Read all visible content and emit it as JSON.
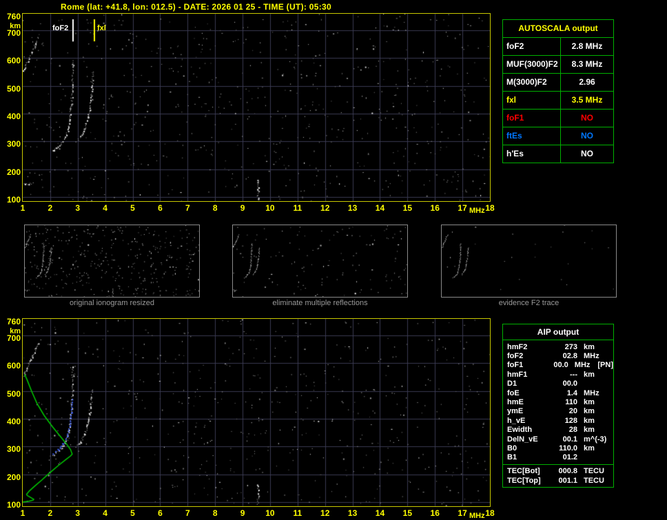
{
  "title": "Rome (lat: +41.8, lon: 012.5) - DATE: 2026 01 25 - TIME (UT): 05:30",
  "ionogram": {
    "x_unit": "MHz",
    "y_unit": "km",
    "foF2_marker": "foF2",
    "fxI_marker": "fxl",
    "x_ticks": [
      1,
      2,
      3,
      4,
      5,
      6,
      7,
      8,
      9,
      10,
      11,
      12,
      13,
      14,
      15,
      16,
      17,
      18
    ],
    "y_ticks": [
      760,
      700,
      600,
      500,
      400,
      300,
      200,
      100
    ]
  },
  "autoscala": {
    "header": "AUTOSCALA output",
    "rows": [
      {
        "label": "foF2",
        "value": "2.8 MHz",
        "color": "white"
      },
      {
        "label": "MUF(3000)F2",
        "value": "8.3 MHz",
        "color": "white"
      },
      {
        "label": "M(3000)F2",
        "value": "2.96",
        "color": "white"
      },
      {
        "label": "fxl",
        "value": "3.5 MHz",
        "color": "yellow"
      },
      {
        "label": "foF1",
        "value": "NO",
        "color": "red"
      },
      {
        "label": "ftEs",
        "value": "NO",
        "color": "blue"
      },
      {
        "label": "h'Es",
        "value": "NO",
        "color": "white"
      }
    ]
  },
  "thumbnails": [
    {
      "caption": "original ionogram resized"
    },
    {
      "caption": "eliminate multiple reflections"
    },
    {
      "caption": "evidence F2 trace"
    }
  ],
  "aip": {
    "header": "AIP output",
    "rows": [
      {
        "label": "hmF2",
        "value": "273",
        "unit": "km",
        "extra": ""
      },
      {
        "label": "foF2",
        "value": "02.8",
        "unit": "MHz",
        "extra": ""
      },
      {
        "label": "foF1",
        "value": "00.0",
        "unit": "MHz",
        "extra": "[PN]"
      },
      {
        "label": "hmF1",
        "value": "---",
        "unit": "km",
        "extra": ""
      },
      {
        "label": "D1",
        "value": "00.0",
        "unit": "",
        "extra": ""
      },
      {
        "label": "foE",
        "value": "1.4",
        "unit": "MHz",
        "extra": ""
      },
      {
        "label": "hmE",
        "value": "110",
        "unit": "km",
        "extra": ""
      },
      {
        "label": "ymE",
        "value": "20",
        "unit": "km",
        "extra": ""
      },
      {
        "label": "h_vE",
        "value": "128",
        "unit": "km",
        "extra": ""
      },
      {
        "label": "Ewidth",
        "value": "28",
        "unit": "km",
        "extra": ""
      },
      {
        "label": "DelN_vE",
        "value": "00.1",
        "unit": "m^(-3)",
        "extra": ""
      },
      {
        "label": "B0",
        "value": "110.0",
        "unit": "km",
        "extra": ""
      },
      {
        "label": "B1",
        "value": "01.2",
        "unit": "",
        "extra": ""
      },
      {
        "label": "TEC[Bot]",
        "value": "000.8",
        "unit": "TECU",
        "extra": "",
        "sep": true
      },
      {
        "label": "TEC[Top]",
        "value": "001.1",
        "unit": "TECU",
        "extra": ""
      }
    ]
  },
  "chart_data": [
    {
      "id": "ionogram-main",
      "type": "scatter",
      "title": "",
      "xlabel": "MHz",
      "ylabel": "km",
      "xlim": [
        1,
        18
      ],
      "ylim": [
        100,
        760
      ],
      "x_ticks": [
        1,
        2,
        3,
        4,
        5,
        6,
        7,
        8,
        9,
        10,
        11,
        12,
        13,
        14,
        15,
        16,
        17,
        18
      ],
      "y_ticks": [
        760,
        700,
        600,
        500,
        400,
        300,
        200,
        100
      ],
      "grid": true,
      "markers": {
        "foF2_MHz": 2.8,
        "fxI_MHz": 3.5
      },
      "series": [
        {
          "name": "F2 ordinary trace",
          "style": "dots-white",
          "points": [
            [
              2.08,
              268
            ],
            [
              2.22,
              278
            ],
            [
              2.38,
              292
            ],
            [
              2.52,
              312
            ],
            [
              2.62,
              340
            ],
            [
              2.7,
              380
            ],
            [
              2.75,
              428
            ],
            [
              2.79,
              485
            ],
            [
              2.82,
              590
            ]
          ]
        },
        {
          "name": "F2 extraordinary trace",
          "style": "dots-white",
          "points": [
            [
              2.95,
              300
            ],
            [
              3.1,
              318
            ],
            [
              3.25,
              347
            ],
            [
              3.37,
              388
            ],
            [
              3.46,
              442
            ],
            [
              3.52,
              505
            ],
            [
              3.55,
              550
            ]
          ]
        },
        {
          "name": "multiple reflection",
          "style": "dots-white",
          "points": [
            [
              1.02,
              555
            ],
            [
              1.15,
              585
            ],
            [
              1.3,
              615
            ],
            [
              1.45,
              650
            ],
            [
              1.56,
              675
            ]
          ]
        },
        {
          "name": "sporadic echoes",
          "style": "dots-white",
          "points": [
            [
              1.02,
              150
            ],
            [
              1.18,
              147
            ],
            [
              1.35,
              151
            ]
          ]
        },
        {
          "name": "interference line",
          "style": "dots-white",
          "points": [
            [
              9.55,
              92
            ],
            [
              9.55,
              162
            ]
          ]
        }
      ]
    },
    {
      "id": "ionogram-aip",
      "type": "scatter",
      "title": "",
      "xlabel": "MHz",
      "ylabel": "km",
      "xlim": [
        1,
        18
      ],
      "ylim": [
        100,
        760
      ],
      "grid": true,
      "markers": {
        "foF2_MHz": 2.8,
        "fxI_MHz": 3.5
      },
      "series": [
        {
          "name": "F2 ordinary trace",
          "style": "dots-white",
          "points": [
            [
              2.08,
              268
            ],
            [
              2.22,
              278
            ],
            [
              2.38,
              292
            ],
            [
              2.52,
              312
            ],
            [
              2.62,
              340
            ],
            [
              2.7,
              380
            ],
            [
              2.75,
              428
            ],
            [
              2.79,
              485
            ],
            [
              2.82,
              590
            ]
          ]
        },
        {
          "name": "F2 extraordinary trace",
          "style": "dots-white",
          "points": [
            [
              2.95,
              300
            ],
            [
              3.1,
              318
            ],
            [
              3.25,
              347
            ],
            [
              3.37,
              388
            ],
            [
              3.46,
              442
            ],
            [
              3.52,
              505
            ]
          ]
        },
        {
          "name": "multiple reflection",
          "style": "dots-white",
          "points": [
            [
              1.02,
              555
            ],
            [
              1.15,
              585
            ],
            [
              1.3,
              615
            ],
            [
              1.45,
              650
            ],
            [
              1.56,
              675
            ]
          ]
        },
        {
          "name": "interference line",
          "style": "dots-white",
          "points": [
            [
              9.55,
              92
            ],
            [
              9.55,
              162
            ]
          ]
        },
        {
          "name": "restored F2 trace",
          "style": "dots-blue",
          "points": [
            [
              2.08,
              276
            ],
            [
              2.28,
              290
            ],
            [
              2.45,
              310
            ],
            [
              2.6,
              338
            ],
            [
              2.7,
              376
            ],
            [
              2.76,
              424
            ],
            [
              2.8,
              470
            ]
          ]
        },
        {
          "name": "electron density profile",
          "style": "line-green",
          "points": [
            [
              1.0,
              100
            ],
            [
              1.22,
              103
            ],
            [
              1.38,
              107
            ],
            [
              1.4,
              110
            ],
            [
              1.28,
              117
            ],
            [
              1.16,
              124
            ],
            [
              1.14,
              128
            ],
            [
              1.24,
              140
            ],
            [
              1.44,
              158
            ],
            [
              1.7,
              180
            ],
            [
              1.98,
              205
            ],
            [
              2.3,
              232
            ],
            [
              2.58,
              254
            ],
            [
              2.74,
              266
            ],
            [
              2.8,
              273
            ],
            [
              2.74,
              289
            ],
            [
              2.58,
              311
            ],
            [
              2.34,
              340
            ],
            [
              2.06,
              374
            ],
            [
              1.78,
              412
            ],
            [
              1.52,
              455
            ],
            [
              1.32,
              500
            ],
            [
              1.16,
              540
            ],
            [
              1.07,
              560
            ]
          ]
        }
      ]
    }
  ]
}
